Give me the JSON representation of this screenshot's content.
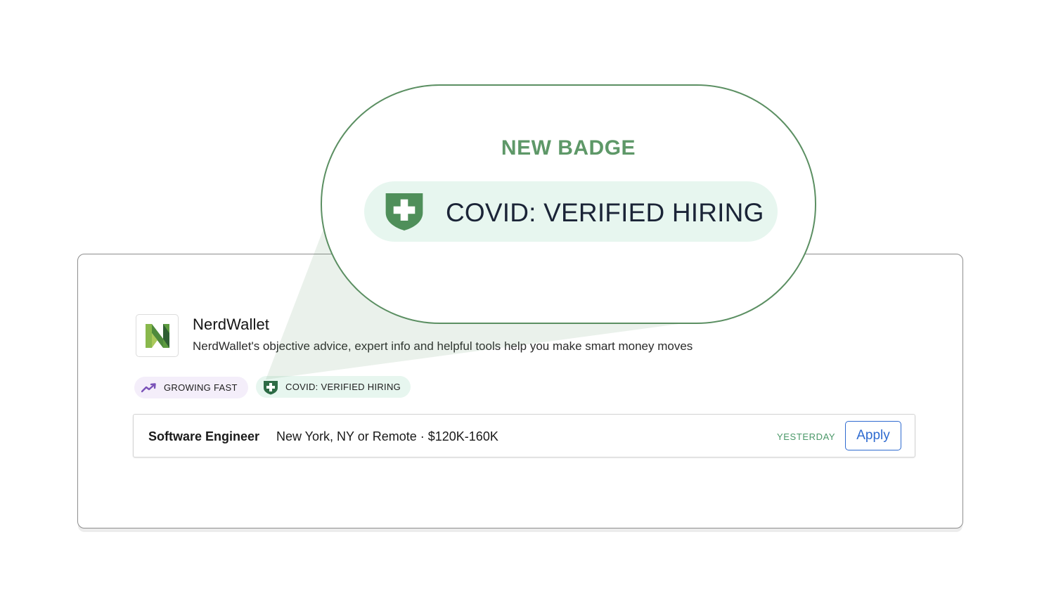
{
  "callout": {
    "title": "NEW BADGE",
    "badge_label": "COVID: VERIFIED HIRING"
  },
  "company": {
    "name": "NerdWallet",
    "description": "NerdWallet's objective advice, expert info and helpful tools help you make smart money moves",
    "logo_icon": "nerdwallet-logo"
  },
  "badges": [
    {
      "label": "GROWING FAST",
      "icon": "trending-up-icon"
    },
    {
      "label": "COVID: VERIFIED HIRING",
      "icon": "shield-plus-icon"
    }
  ],
  "job": {
    "title": "Software Engineer",
    "meta": "New York, NY or Remote · $120K-160K",
    "posted": "YESTERDAY",
    "apply_label": "Apply"
  },
  "colors": {
    "accent_green": "#5b8f62",
    "badge_green_bg": "#e7f6ef",
    "badge_purple_bg": "#f4eefa",
    "link_blue": "#2f6bd0"
  }
}
